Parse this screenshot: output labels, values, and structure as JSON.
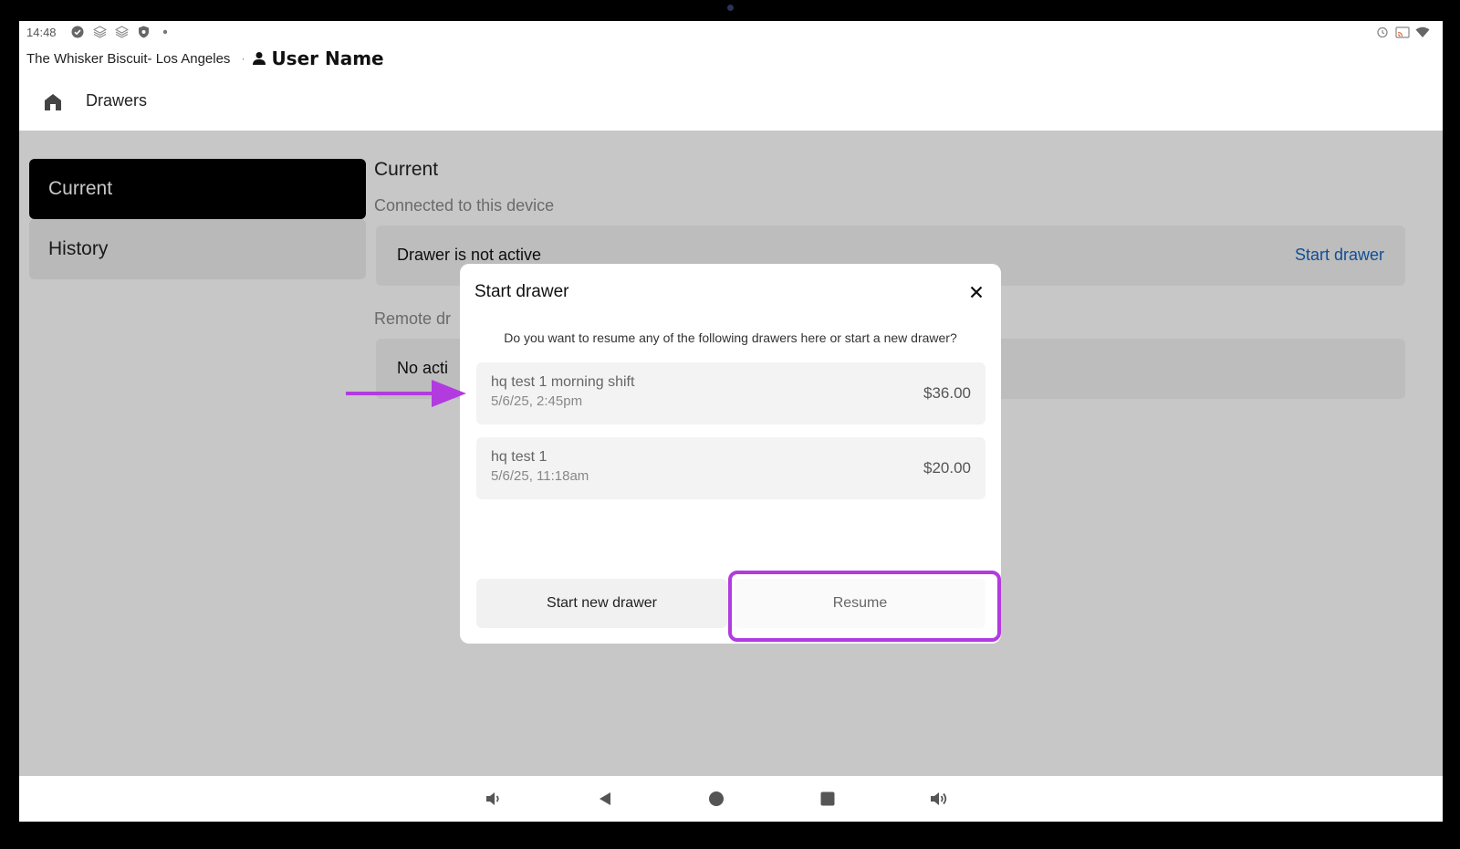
{
  "status_bar": {
    "time": "14:48",
    "left_icons": [
      "check-circle-icon",
      "layers-icon",
      "layers-icon",
      "shield-icon",
      "dot-icon"
    ],
    "right_icons": [
      "alarm-icon",
      "cast-icon",
      "wifi-icon"
    ]
  },
  "header": {
    "location": "The Whisker Biscuit- Los Angeles",
    "separator": "·",
    "user_name": "User Name"
  },
  "app_bar": {
    "title": "Drawers"
  },
  "sidebar": {
    "items": [
      {
        "label": "Current",
        "selected": true
      },
      {
        "label": "History",
        "selected": false
      }
    ]
  },
  "main": {
    "title": "Current",
    "connected_label": "Connected to this device",
    "drawer_status": "Drawer is not active",
    "start_drawer_link": "Start drawer",
    "remote_label": "Remote dr",
    "remote_status": "No acti"
  },
  "dialog": {
    "title": "Start drawer",
    "message": "Do you want to resume any of the following drawers here or start a new drawer?",
    "drawers": [
      {
        "name": "hq test 1 morning shift",
        "date": "5/6/25, 2:45pm",
        "amount": "$36.00"
      },
      {
        "name": "hq test 1",
        "date": "5/6/25, 11:18am",
        "amount": "$20.00"
      }
    ],
    "start_new_label": "Start new drawer",
    "resume_label": "Resume"
  },
  "colors": {
    "accent_link": "#1565c0",
    "annotation": "#b23be0",
    "selected_bg": "#000000"
  }
}
